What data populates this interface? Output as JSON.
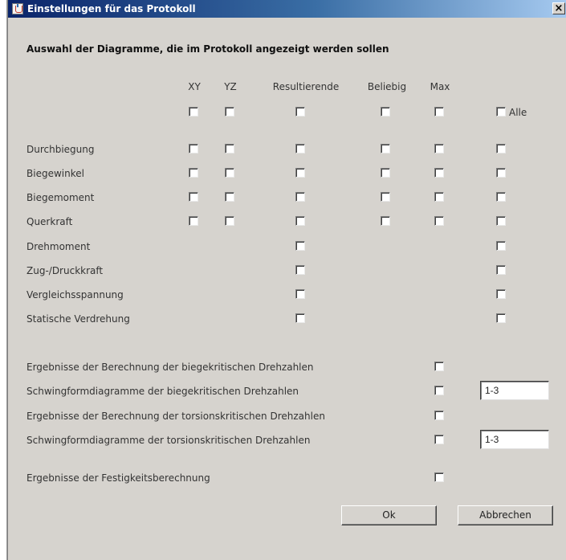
{
  "window": {
    "title": "Einstellungen für das Protokoll",
    "close_label": "×"
  },
  "heading": "Auswahl der Diagramme, die im Protokoll angezeigt werden sollen",
  "columns": [
    "XY",
    "YZ",
    "Resultierende",
    "Beliebig",
    "Max"
  ],
  "all_label": "Alle",
  "diagram_rows": [
    {
      "label": "Durchbiegung"
    },
    {
      "label": "Biegewinkel"
    },
    {
      "label": "Biegemoment"
    },
    {
      "label": "Querkraft"
    },
    {
      "label": "Drehmoment"
    },
    {
      "label": "Zug-/Druckkraft"
    },
    {
      "label": "Vergleichsspannung"
    },
    {
      "label": "Statische Verdrehung"
    }
  ],
  "result_rows": [
    {
      "label": "Ergebnisse der Berechnung der biegekritischen Drehzahlen"
    },
    {
      "label": "Schwingformdiagramme der biegekritischen Drehzahlen",
      "input_value": "1-3"
    },
    {
      "label": "Ergebnisse der Berechnung der torsionskritischen Drehzahlen"
    },
    {
      "label": "Schwingformdiagramme der torsionskritischen Drehzahlen",
      "input_value": "1-3"
    },
    {
      "label": "Ergebnisse der Festigkeitsberechnung"
    }
  ],
  "buttons": {
    "ok": "Ok",
    "cancel": "Abbrechen"
  }
}
